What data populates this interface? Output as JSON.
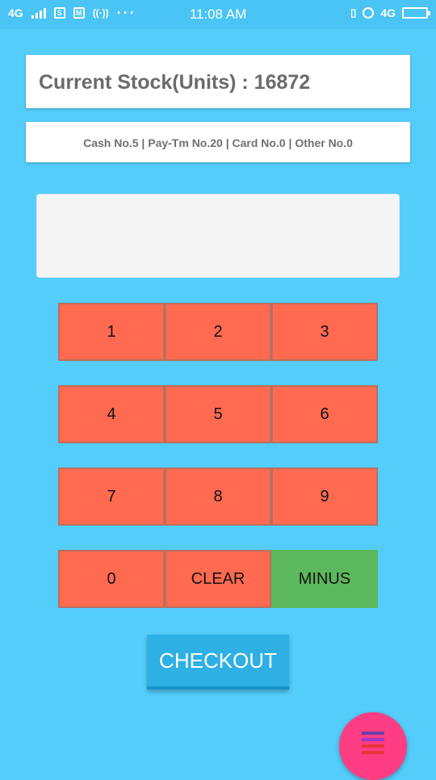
{
  "status_bar": {
    "network_left": "4G",
    "time": "11:08 AM",
    "network_right": "4G",
    "icons": [
      "signal-icon",
      "sim-icon",
      "mail-icon",
      "hotspot-icon",
      "more-dots-icon",
      "vibrate-icon",
      "alarm-icon",
      "battery-icon"
    ]
  },
  "stock": {
    "text": "Current Stock(Units) : 16872"
  },
  "payments": {
    "text": "Cash  No.5 | Pay-Tm  No.20 | Card  No.0 | Other  No.0"
  },
  "display": {
    "value": ""
  },
  "keypad": {
    "k1": "1",
    "k2": "2",
    "k3": "3",
    "k4": "4",
    "k5": "5",
    "k6": "6",
    "k7": "7",
    "k8": "8",
    "k9": "9",
    "k0": "0",
    "clear": "CLEAR",
    "minus": "MINUS"
  },
  "checkout": {
    "label": "CHECKOUT"
  },
  "fab": {
    "icon": "menu-icon",
    "bar_colors": [
      "#6a3fa8",
      "#a037c9",
      "#e8343a",
      "#e8343a"
    ]
  },
  "colors": {
    "background": "#54cdfb",
    "key": "#ff6a50",
    "minus_key": "#5cb85c",
    "checkout": "#2eb0e4",
    "fab": "#ff3d84"
  }
}
